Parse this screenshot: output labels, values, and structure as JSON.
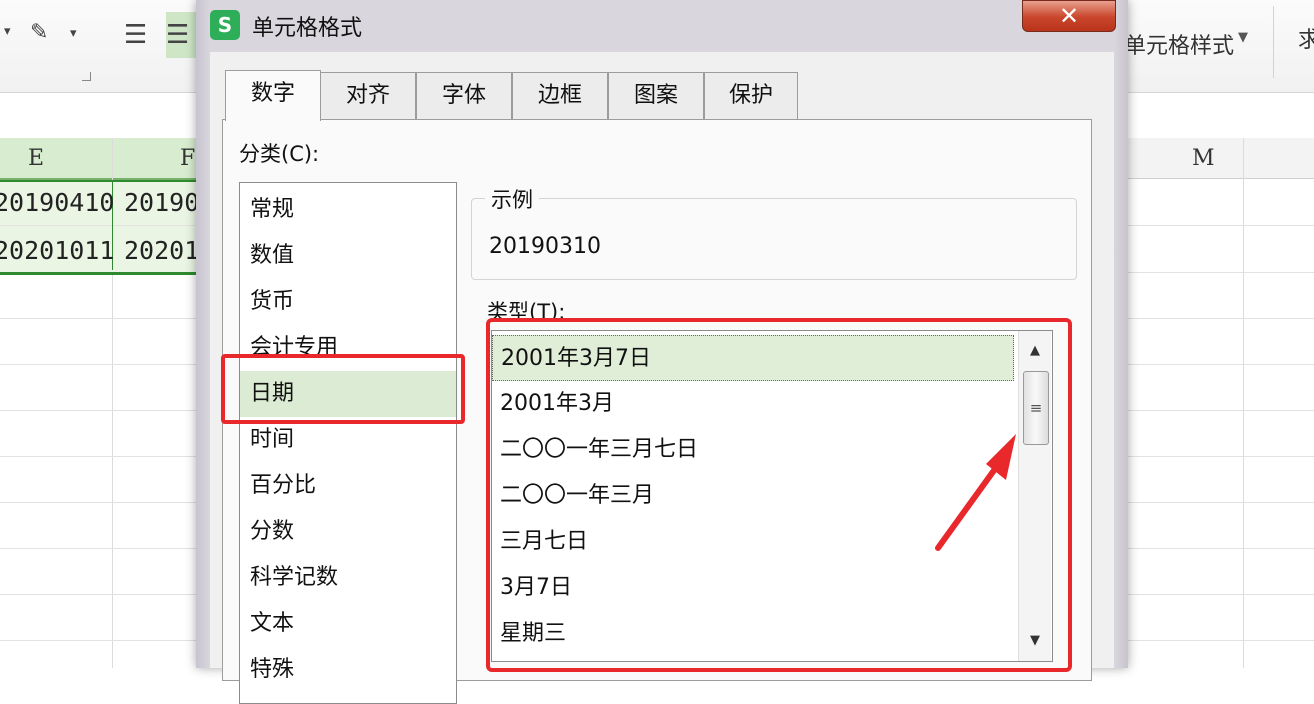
{
  "spreadsheet": {
    "ribbon": {
      "cell_style_label": "单元格样式",
      "partial_label": "求"
    },
    "columns": {
      "e": "E",
      "f": "F",
      "m": "M"
    },
    "cells": {
      "e1": "20190410",
      "f1": "20190",
      "e2": "20201011",
      "f2": "20201"
    }
  },
  "dialog": {
    "title": "单元格格式",
    "app_icon": "S",
    "close": "✕",
    "tabs": [
      {
        "label": "数字"
      },
      {
        "label": "对齐"
      },
      {
        "label": "字体"
      },
      {
        "label": "边框"
      },
      {
        "label": "图案"
      },
      {
        "label": "保护"
      }
    ],
    "category_label": "分类(C):",
    "categories": [
      {
        "label": "常规"
      },
      {
        "label": "数值"
      },
      {
        "label": "货币"
      },
      {
        "label": "会计专用"
      },
      {
        "label": "日期"
      },
      {
        "label": "时间"
      },
      {
        "label": "百分比"
      },
      {
        "label": "分数"
      },
      {
        "label": "科学记数"
      },
      {
        "label": "文本"
      },
      {
        "label": "特殊"
      }
    ],
    "selected_category": "日期",
    "sample_label": "示例",
    "sample_value": "20190310",
    "type_label": "类型(T):",
    "types": [
      {
        "label": "2001年3月7日"
      },
      {
        "label": "2001年3月"
      },
      {
        "label": "二〇〇一年三月七日"
      },
      {
        "label": "二〇〇一年三月"
      },
      {
        "label": "三月七日"
      },
      {
        "label": "3月7日"
      },
      {
        "label": "星期三"
      }
    ],
    "selected_type": "2001年3月7日"
  },
  "colors": {
    "annotation_red": "#e8282b",
    "selection_green": "#dcebd4",
    "close_red": "#c9452a",
    "app_green": "#2fae5a"
  },
  "icons": [
    "app-icon",
    "close-icon",
    "scroll-up-icon",
    "scroll-down-icon",
    "scroll-grip-icon",
    "annotation-arrow"
  ]
}
